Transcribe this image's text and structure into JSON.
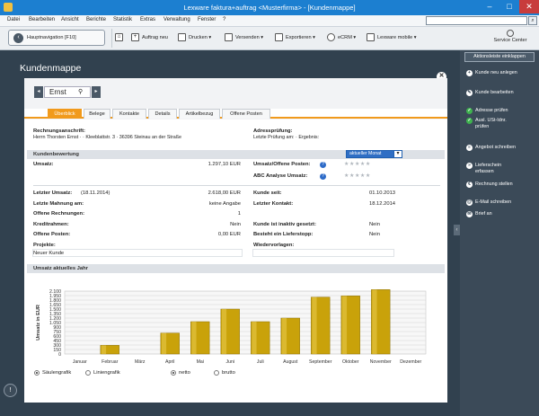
{
  "window": {
    "title": "Lexware faktura+auftrag <Musterfirma> - [Kundenmappe]",
    "minimize": "–",
    "maximize": "□",
    "close": "✕"
  },
  "menu": [
    "Datei",
    "Bearbeiten",
    "Ansicht",
    "Berichte",
    "Statistik",
    "Extras",
    "Verwaltung",
    "Fenster",
    "?"
  ],
  "toolbar": {
    "hauptnavigation": "Hauptnavigation [F10]",
    "items": [
      "Auftrag neu",
      "Drucken",
      "Versenden",
      "Exportieren",
      "eCRM",
      "Lexware mobile"
    ],
    "service_center": "Service Center"
  },
  "page": {
    "title": "Kundenmappe"
  },
  "customer_nav": {
    "name": "Ernst"
  },
  "tabs": [
    "Überblick",
    "Belege",
    "Kontakte",
    "Details",
    "Artikelbezug",
    "Offene Posten"
  ],
  "address": {
    "rechnung_label": "Rechnungsanschrift:",
    "rechnung_value": "Herrn Thorsten Ernst · · Kleeblattstr. 3 · 36396 Steinau an der Straße",
    "pruefung_label": "Adressprüfung:",
    "pruefung_value": "Letzte Prüfung am: · Ergebnis:"
  },
  "kundenbewertung": {
    "title": "Kundenbewertung",
    "select": "aktueller Monat",
    "umsatz_label": "Umsatz:",
    "umsatz_value": "1.297,10 EUR",
    "umsatz_op_label": "Umsatz/Offene Posten:",
    "abc_label": "ABC Analyse Umsatz:",
    "rows_left": [
      {
        "label": "Letzter Umsatz:",
        "sub": "(18.11.2014)",
        "value": "2.618,00 EUR"
      },
      {
        "label": "Letzte Mahnung am:",
        "sub": "",
        "value": "keine Angabe"
      },
      {
        "label": "Offene Rechnungen:",
        "sub": "",
        "value": "1"
      },
      {
        "label": "Kreditrahmen:",
        "sub": "",
        "value": "Nein"
      },
      {
        "label": "Offene Posten:",
        "sub": "",
        "value": "0,00 EUR"
      }
    ],
    "rows_right": [
      {
        "label": "Kunde seit:",
        "value": "01.10.2013"
      },
      {
        "label": "Letzter Kontakt:",
        "value": "18.12.2014"
      },
      {
        "label": "Kunde ist inaktiv gesetzt:",
        "value": "Nein"
      },
      {
        "label": "Besteht ein Lieferstopp:",
        "value": "Nein"
      }
    ],
    "projekte_label": "Projekte:",
    "projekte_value": "Neuer Kunde",
    "wiedervorlagen_label": "Wiedervorlagen:"
  },
  "umsatz": {
    "title": "Umsatz aktuelles Jahr",
    "radio": [
      "Säulengrafik",
      "Liniengrafik",
      "netto",
      "brutto"
    ]
  },
  "chart_data": {
    "type": "bar",
    "categories": [
      "Januar",
      "Februar",
      "März",
      "April",
      "Mai",
      "Juni",
      "Juli",
      "August",
      "September",
      "Oktober",
      "November",
      "Dezember"
    ],
    "values": [
      0,
      290,
      0,
      700,
      1080,
      1500,
      1080,
      1200,
      1900,
      1940,
      2150,
      0
    ],
    "ylabel": "Umsatz in EUR",
    "yticks": [
      "0",
      "150",
      "300",
      "450",
      "600",
      "750",
      "900",
      "1.050",
      "1.200",
      "1.350",
      "1.500",
      "1.650",
      "1.800",
      "1.950",
      "2.100"
    ],
    "ylim": [
      0,
      2100
    ],
    "grid": true,
    "bar_color": "#c9a20a"
  },
  "sidebar": {
    "header": "Aktionsleiste einklappen",
    "actions": [
      "Kunde neu anlegen",
      "Kunde bearbeiten",
      "Adresse prüfen",
      "Ausl. USt-Idnr. prüfen",
      "Angebot schreiben",
      "Lieferschein erfassen",
      "Rechnung stellen",
      "E-Mail schreiben",
      "Brief an"
    ]
  }
}
